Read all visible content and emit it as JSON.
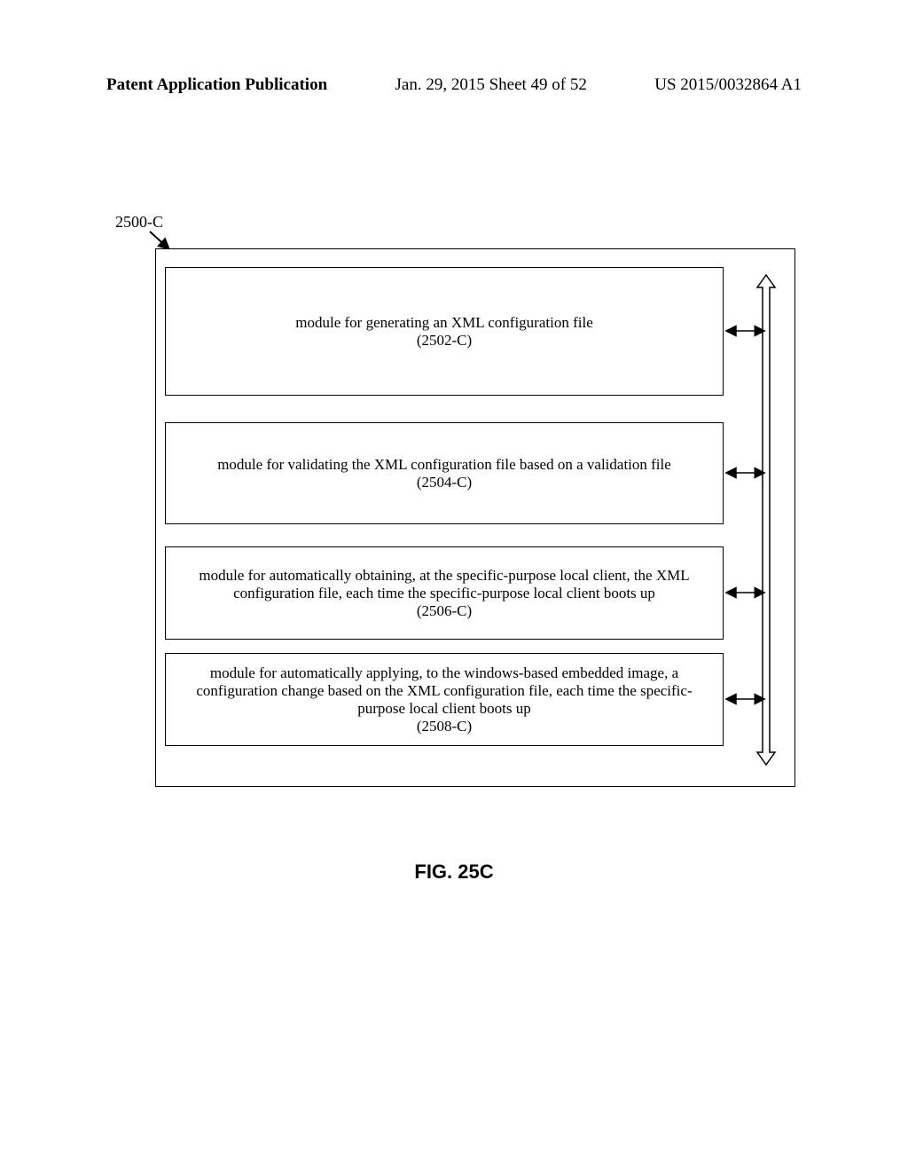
{
  "header": {
    "left": "Patent Application Publication",
    "mid": "Jan. 29, 2015  Sheet 49 of 52",
    "right": "US 2015/0032864 A1"
  },
  "reference_label": "2500-C",
  "modules": {
    "m1": "module for generating an XML configuration file\n(2502-C)",
    "m2": "module for validating the XML configuration file based on a validation file\n(2504-C)",
    "m3": "module for automatically obtaining, at the specific-purpose local client, the XML configuration file, each time the specific-purpose local client boots up\n(2506-C)",
    "m4": "module for automatically applying, to the windows-based embedded image, a configuration change based on the XML configuration file, each time the specific-purpose local client boots up\n(2508-C)"
  },
  "figure_caption": "FIG. 25C",
  "chart_data": {
    "type": "diagram",
    "title": "FIG. 25C",
    "reference": "2500-C",
    "modules": [
      {
        "id": "2502-C",
        "description": "module for generating an XML configuration file"
      },
      {
        "id": "2504-C",
        "description": "module for validating the XML configuration file based on a validation file"
      },
      {
        "id": "2506-C",
        "description": "module for automatically obtaining, at the specific-purpose local client, the XML configuration file, each time the specific-purpose local client boots up"
      },
      {
        "id": "2508-C",
        "description": "module for automatically applying, to the windows-based embedded image, a configuration change based on the XML configuration file, each time the specific-purpose local client boots up"
      }
    ],
    "bus": {
      "description": "vertical double-headed bus connecting all modules bidirectionally"
    }
  }
}
